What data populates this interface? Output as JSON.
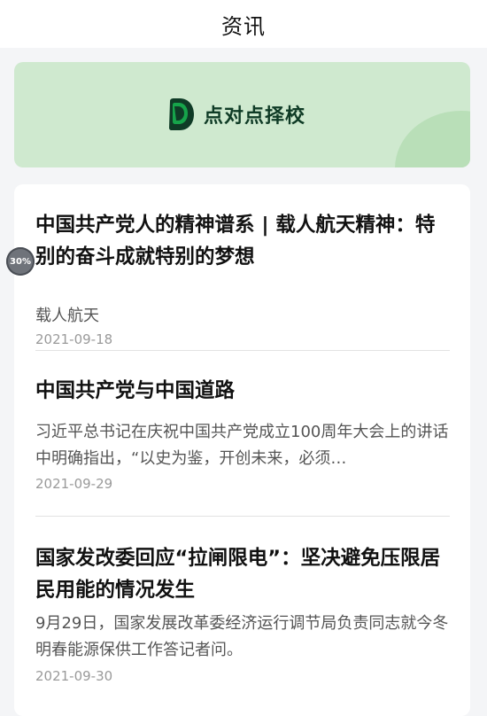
{
  "header": {
    "title": "资讯"
  },
  "banner": {
    "logo_text": "点对点择校",
    "logo_icon": "brand-leaf-icon",
    "colors": {
      "background": "#cfe9cf",
      "accent": "#b9dfb8",
      "logo_dark": "#0f3b26",
      "logo_green": "#16a34a"
    }
  },
  "progress_badge": {
    "label": "30%",
    "value": 0.3
  },
  "news": [
    {
      "title": "中国共产党人的精神谱系 | 载人航天精神：特别的奋斗成就特别的梦想",
      "summary": "载人航天",
      "date": "2021-09-18"
    },
    {
      "title": "中国共产党与中国道路",
      "summary": "习近平总书记在庆祝中国共产党成立100周年大会上的讲话中明确指出，“以史为鉴，开创未来，必须…",
      "date": "2021-09-29"
    },
    {
      "title": "国家发改委回应“拉闸限电”：坚决避免压限居民用能的情况发生",
      "summary": "9月29日，国家发展改革委经济运行调节局负责同志就今冬明春能源保供工作答记者问。",
      "date": "2021-09-30"
    }
  ]
}
